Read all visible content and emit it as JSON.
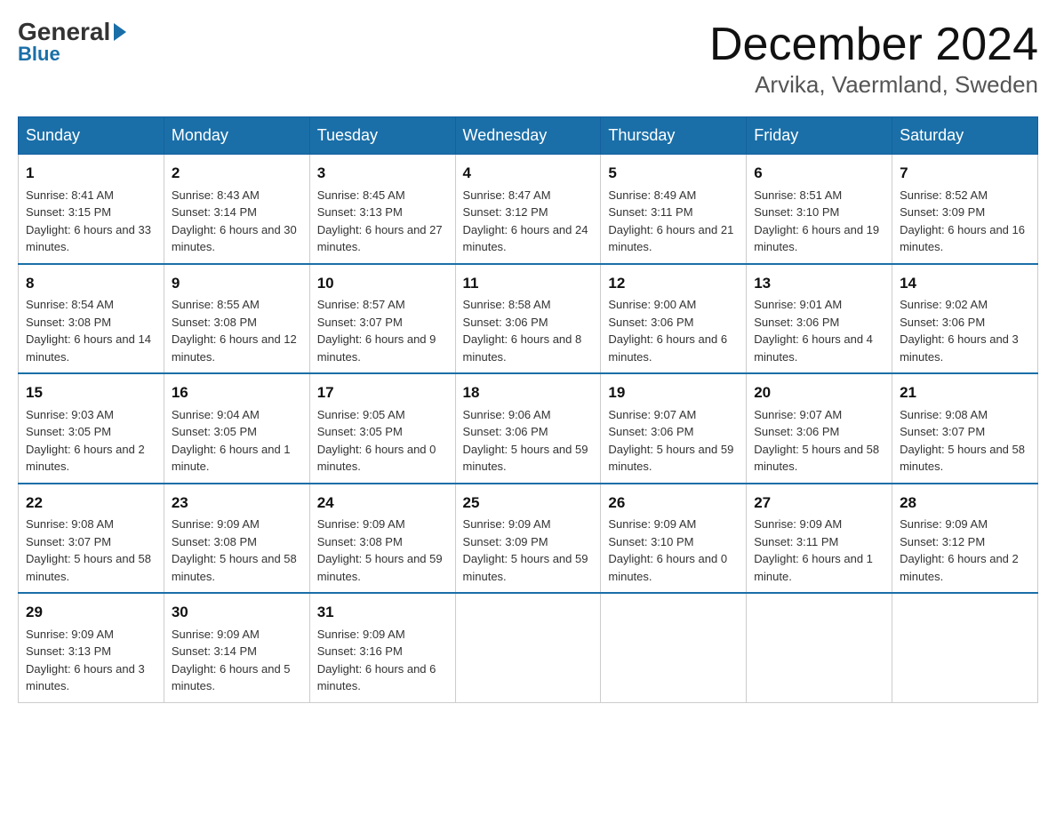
{
  "logo": {
    "general": "General",
    "blue": "Blue"
  },
  "title": "December 2024",
  "location": "Arvika, Vaermland, Sweden",
  "headers": [
    "Sunday",
    "Monday",
    "Tuesday",
    "Wednesday",
    "Thursday",
    "Friday",
    "Saturday"
  ],
  "weeks": [
    [
      {
        "day": "1",
        "sunrise": "8:41 AM",
        "sunset": "3:15 PM",
        "daylight": "6 hours and 33 minutes."
      },
      {
        "day": "2",
        "sunrise": "8:43 AM",
        "sunset": "3:14 PM",
        "daylight": "6 hours and 30 minutes."
      },
      {
        "day": "3",
        "sunrise": "8:45 AM",
        "sunset": "3:13 PM",
        "daylight": "6 hours and 27 minutes."
      },
      {
        "day": "4",
        "sunrise": "8:47 AM",
        "sunset": "3:12 PM",
        "daylight": "6 hours and 24 minutes."
      },
      {
        "day": "5",
        "sunrise": "8:49 AM",
        "sunset": "3:11 PM",
        "daylight": "6 hours and 21 minutes."
      },
      {
        "day": "6",
        "sunrise": "8:51 AM",
        "sunset": "3:10 PM",
        "daylight": "6 hours and 19 minutes."
      },
      {
        "day": "7",
        "sunrise": "8:52 AM",
        "sunset": "3:09 PM",
        "daylight": "6 hours and 16 minutes."
      }
    ],
    [
      {
        "day": "8",
        "sunrise": "8:54 AM",
        "sunset": "3:08 PM",
        "daylight": "6 hours and 14 minutes."
      },
      {
        "day": "9",
        "sunrise": "8:55 AM",
        "sunset": "3:08 PM",
        "daylight": "6 hours and 12 minutes."
      },
      {
        "day": "10",
        "sunrise": "8:57 AM",
        "sunset": "3:07 PM",
        "daylight": "6 hours and 9 minutes."
      },
      {
        "day": "11",
        "sunrise": "8:58 AM",
        "sunset": "3:06 PM",
        "daylight": "6 hours and 8 minutes."
      },
      {
        "day": "12",
        "sunrise": "9:00 AM",
        "sunset": "3:06 PM",
        "daylight": "6 hours and 6 minutes."
      },
      {
        "day": "13",
        "sunrise": "9:01 AM",
        "sunset": "3:06 PM",
        "daylight": "6 hours and 4 minutes."
      },
      {
        "day": "14",
        "sunrise": "9:02 AM",
        "sunset": "3:06 PM",
        "daylight": "6 hours and 3 minutes."
      }
    ],
    [
      {
        "day": "15",
        "sunrise": "9:03 AM",
        "sunset": "3:05 PM",
        "daylight": "6 hours and 2 minutes."
      },
      {
        "day": "16",
        "sunrise": "9:04 AM",
        "sunset": "3:05 PM",
        "daylight": "6 hours and 1 minute."
      },
      {
        "day": "17",
        "sunrise": "9:05 AM",
        "sunset": "3:05 PM",
        "daylight": "6 hours and 0 minutes."
      },
      {
        "day": "18",
        "sunrise": "9:06 AM",
        "sunset": "3:06 PM",
        "daylight": "5 hours and 59 minutes."
      },
      {
        "day": "19",
        "sunrise": "9:07 AM",
        "sunset": "3:06 PM",
        "daylight": "5 hours and 59 minutes."
      },
      {
        "day": "20",
        "sunrise": "9:07 AM",
        "sunset": "3:06 PM",
        "daylight": "5 hours and 58 minutes."
      },
      {
        "day": "21",
        "sunrise": "9:08 AM",
        "sunset": "3:07 PM",
        "daylight": "5 hours and 58 minutes."
      }
    ],
    [
      {
        "day": "22",
        "sunrise": "9:08 AM",
        "sunset": "3:07 PM",
        "daylight": "5 hours and 58 minutes."
      },
      {
        "day": "23",
        "sunrise": "9:09 AM",
        "sunset": "3:08 PM",
        "daylight": "5 hours and 58 minutes."
      },
      {
        "day": "24",
        "sunrise": "9:09 AM",
        "sunset": "3:08 PM",
        "daylight": "5 hours and 59 minutes."
      },
      {
        "day": "25",
        "sunrise": "9:09 AM",
        "sunset": "3:09 PM",
        "daylight": "5 hours and 59 minutes."
      },
      {
        "day": "26",
        "sunrise": "9:09 AM",
        "sunset": "3:10 PM",
        "daylight": "6 hours and 0 minutes."
      },
      {
        "day": "27",
        "sunrise": "9:09 AM",
        "sunset": "3:11 PM",
        "daylight": "6 hours and 1 minute."
      },
      {
        "day": "28",
        "sunrise": "9:09 AM",
        "sunset": "3:12 PM",
        "daylight": "6 hours and 2 minutes."
      }
    ],
    [
      {
        "day": "29",
        "sunrise": "9:09 AM",
        "sunset": "3:13 PM",
        "daylight": "6 hours and 3 minutes."
      },
      {
        "day": "30",
        "sunrise": "9:09 AM",
        "sunset": "3:14 PM",
        "daylight": "6 hours and 5 minutes."
      },
      {
        "day": "31",
        "sunrise": "9:09 AM",
        "sunset": "3:16 PM",
        "daylight": "6 hours and 6 minutes."
      },
      null,
      null,
      null,
      null
    ]
  ]
}
